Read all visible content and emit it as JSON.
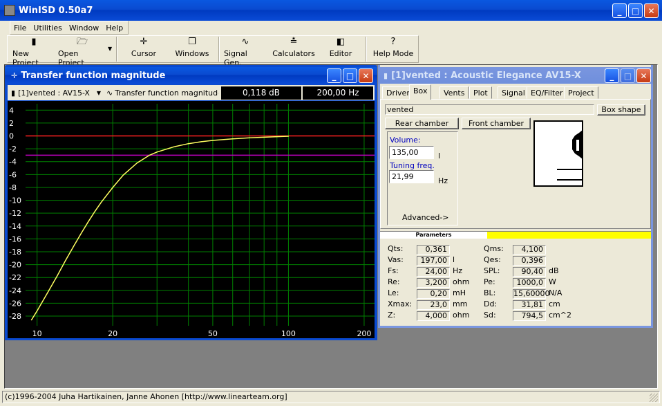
{
  "app": {
    "title": "WinISD 0.50a7",
    "menu": [
      "File",
      "Utilities",
      "Window",
      "Help"
    ],
    "toolbar": {
      "new_project": "New Project",
      "open_project": "Open Project",
      "cursor": "Cursor",
      "windows": "Windows",
      "signal_gen": "Signal Gen.",
      "calculators": "Calculators",
      "editor": "Editor",
      "help_mode": "Help Mode"
    },
    "status": "(c)1996-2004 Juha Hartikainen, Janne Ahonen [http://www.linearteam.org]"
  },
  "graph_window": {
    "title": "Transfer function magnitude",
    "project_select": "[1]vented : AV15-X",
    "graph_select": "Transfer function magnitude",
    "cursor_db": "0,118 dB",
    "cursor_hz": "200,00 Hz"
  },
  "project_window": {
    "title": "[1]vented : Acoustic Elegance AV15-X",
    "tabs": [
      "Driver",
      "Box",
      "Vents",
      "Plot",
      "Signal",
      "EQ/Filter",
      "Project"
    ],
    "active_tab": "Box",
    "box_name": "vented",
    "box_shape_button": "Box shape",
    "rear_chamber": "Rear chamber",
    "front_chamber": "Front chamber",
    "volume_label": "Volume:",
    "volume_value": "135,00",
    "volume_unit": "l",
    "tuning_label": "Tuning freq.",
    "tuning_value": "21,99",
    "tuning_unit": "Hz",
    "advanced": "Advanced->",
    "params_header": "Parameters",
    "params_left": [
      {
        "label": "Qts:",
        "value": "0,361",
        "unit": ""
      },
      {
        "label": "Vas:",
        "value": "197,00",
        "unit": "l"
      },
      {
        "label": "Fs:",
        "value": "24,00",
        "unit": "Hz"
      },
      {
        "label": "Re:",
        "value": "3,200",
        "unit": "ohm"
      },
      {
        "label": "Le:",
        "value": "0,20",
        "unit": "mH"
      },
      {
        "label": "Xmax:",
        "value": "23,0",
        "unit": "mm"
      },
      {
        "label": "Z:",
        "value": "4,000",
        "unit": "ohm"
      }
    ],
    "params_right": [
      {
        "label": "Qms:",
        "value": "4,100",
        "unit": ""
      },
      {
        "label": "Qes:",
        "value": "0,396",
        "unit": ""
      },
      {
        "label": "SPL:",
        "value": "90,40",
        "unit": "dB"
      },
      {
        "label": "Pe:",
        "value": "1000,0",
        "unit": "W"
      },
      {
        "label": "BL:",
        "value": "15,60000",
        "unit": "N/A"
      },
      {
        "label": "Dd:",
        "value": "31,81",
        "unit": "cm"
      },
      {
        "label": "Sd:",
        "value": "794,5",
        "unit": "cm^2"
      }
    ]
  },
  "colors": {
    "graph_bg": "#000000",
    "grid": "#008000",
    "curve": "#ffff60",
    "zero_line": "#ff2020",
    "minus3_line": "#c000c0",
    "accent": "#ffff00"
  },
  "chart_data": {
    "type": "line",
    "x_scale": "log",
    "xlim": [
      9,
      220
    ],
    "ylim": [
      -29.5,
      5
    ],
    "x_ticks": [
      10,
      20,
      50,
      100,
      200
    ],
    "y_ticks": [
      4,
      2,
      0,
      -2,
      -4,
      -6,
      -8,
      -10,
      -12,
      -14,
      -16,
      -18,
      -20,
      -22,
      -24,
      -26,
      -28
    ],
    "reference_lines": [
      0,
      -3
    ],
    "series": [
      {
        "x": [
          9.5,
          10,
          11,
          12,
          13,
          14,
          15,
          16,
          17,
          18,
          20,
          22,
          25,
          28,
          30,
          35,
          40,
          45,
          50,
          60,
          70,
          80,
          90,
          100
        ],
        "y": [
          -28.6,
          -27.2,
          -24.4,
          -21.8,
          -19.3,
          -17.1,
          -15.1,
          -13.3,
          -11.7,
          -10.3,
          -8.0,
          -6.1,
          -4.2,
          -3.0,
          -2.5,
          -1.7,
          -1.2,
          -0.9,
          -0.7,
          -0.45,
          -0.3,
          -0.2,
          -0.12,
          -0.05
        ]
      }
    ]
  }
}
